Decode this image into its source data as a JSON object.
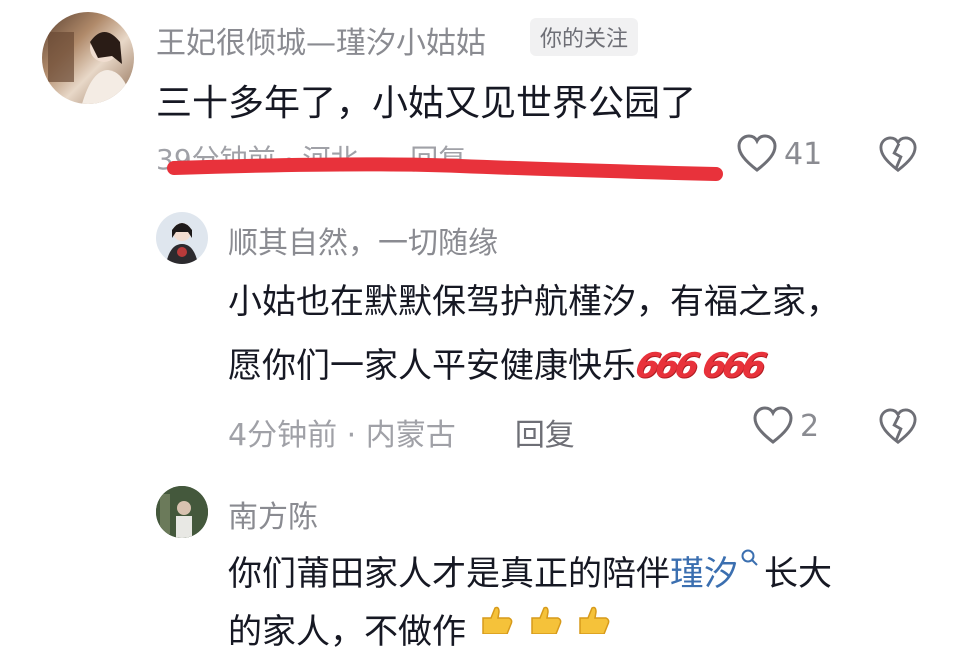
{
  "comments": [
    {
      "username": "王妃很倾城—瑾汐小姑姑",
      "tag": "你的关注",
      "text": "三十多年了，小姑又见世界公园了",
      "time": "39分钟前",
      "location": "河北",
      "reply_label": "回复",
      "likes": "41"
    },
    {
      "username": "顺其自然，一切随缘",
      "text_line1": "小姑也在默默保驾护航槿汐，有福之家，",
      "text_line2": "愿你们一家人平安健康快乐",
      "emoji1": "666",
      "emoji2": "666",
      "time": "4分钟前",
      "location": "内蒙古",
      "reply_label": "回复",
      "likes": "2"
    },
    {
      "username": "南方陈",
      "text_pre": "你们莆田家人才是真正的陪伴",
      "text_link": "瑾汐",
      "text_post": "长大",
      "text_line2": "的家人，不做作"
    }
  ],
  "colors": {
    "underline": "#e8323b",
    "link": "#3b6fb0",
    "emoji": "#e8323b"
  }
}
